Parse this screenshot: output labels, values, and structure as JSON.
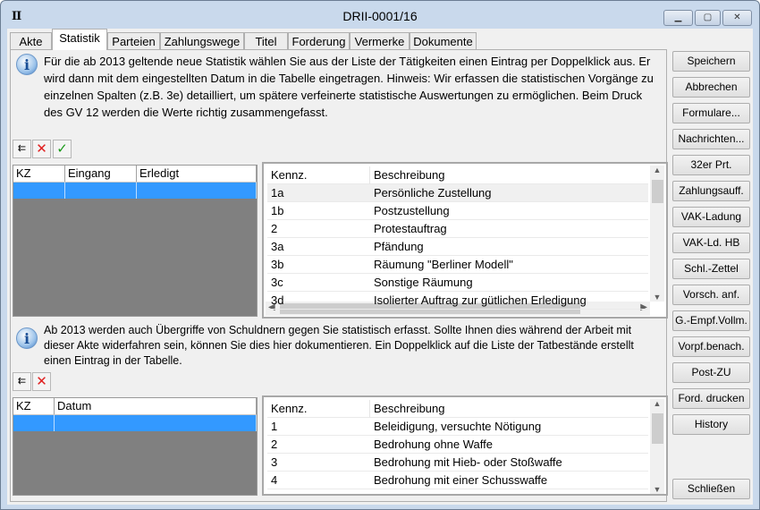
{
  "window": {
    "title": "DRII-0001/16",
    "app_icon": "II"
  },
  "tabs": [
    "Akte",
    "Statistik",
    "Parteien",
    "Zahlungswege",
    "Titel",
    "Forderung",
    "Vermerke",
    "Dokumente"
  ],
  "active_tab": "Statistik",
  "statistik": {
    "info": "Für die ab 2013 geltende neue Statistik wählen Sie aus der Liste der Tätigkeiten einen Eintrag per Doppelklick aus. Er wird dann mit dem eingestellten Datum in die Tabelle eingetragen. Hinweis: Wir erfassen die statistischen Vorgänge zu einzelnen Spalten (z.B. 3e) detailliert, um spätere verfeinerte statistische Auswertungen zu ermöglichen. Beim Druck des GV 12 werden die Werte richtig zusammengefasst.",
    "grid_columns": [
      "KZ",
      "Eingang",
      "Erledigt"
    ],
    "list_columns": [
      "Kennz.",
      "Beschreibung"
    ],
    "list_rows": [
      {
        "k": "1a",
        "d": "Persönliche Zustellung"
      },
      {
        "k": "1b",
        "d": "Postzustellung"
      },
      {
        "k": "2",
        "d": "Protestauftrag"
      },
      {
        "k": "3a",
        "d": "Pfändung"
      },
      {
        "k": "3b",
        "d": "Räumung \"Berliner Modell\""
      },
      {
        "k": "3c",
        "d": "Sonstige Räumung"
      },
      {
        "k": "3d",
        "d": "Isolierter Auftrag zur gütlichen Erledigung"
      }
    ]
  },
  "uebergriffe": {
    "info": "Ab 2013 werden auch Übergriffe von Schuldnern gegen Sie statistisch erfasst. Sollte Ihnen dies während der Arbeit mit dieser Akte widerfahren sein, können Sie dies hier dokumentieren. Ein Doppelklick auf die Liste der Tatbestände erstellt einen Eintrag in der Tabelle.",
    "grid_columns": [
      "KZ",
      "Datum"
    ],
    "list_columns": [
      "Kennz.",
      "Beschreibung"
    ],
    "list_rows": [
      {
        "k": "1",
        "d": "Beleidigung, versuchte Nötigung"
      },
      {
        "k": "2",
        "d": "Bedrohung ohne Waffe"
      },
      {
        "k": "3",
        "d": "Bedrohung mit Hieb- oder Stoßwaffe"
      },
      {
        "k": "4",
        "d": "Bedrohung mit einer Schusswaffe"
      }
    ]
  },
  "buttons": [
    "Speichern",
    "Abbrechen",
    "Formulare...",
    "Nachrichten...",
    "32er Prt.",
    "Zahlungsauff.",
    "VAK-Ladung",
    "VAK-Ld. HB",
    "Schl.-Zettel",
    "Vorsch. anf.",
    "G.-Empf.Vollm.",
    "Vorpf.benach.",
    "Post-ZU",
    "Ford. drucken",
    "History"
  ],
  "close_button": "Schließen",
  "colors": {
    "selection": "#3399ff",
    "grid_empty": "#808080",
    "delete": "#e02020",
    "confirm": "#1a9a1a"
  }
}
